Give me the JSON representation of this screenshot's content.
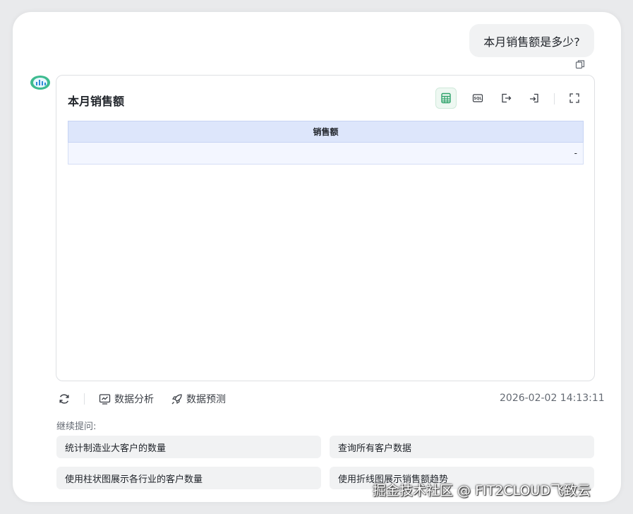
{
  "user_message": "本月销售额是多少?",
  "card": {
    "title": "本月销售额",
    "toolbar": [
      "table-icon",
      "sql-icon",
      "export-icon",
      "import-icon",
      "fullscreen-icon"
    ],
    "table": {
      "columns": [
        "销售额"
      ],
      "rows": [
        [
          "-"
        ]
      ]
    }
  },
  "actions": {
    "analyze_label": "数据分析",
    "predict_label": "数据预测"
  },
  "timestamp": "2026-02-02 14:13:11",
  "follow_up": {
    "label": "继续提问:",
    "suggestions": [
      "统计制造业大客户的数量",
      "查询所有客户数据",
      "使用柱状图展示各行业的客户数量",
      "使用折线图展示销售额趋势"
    ]
  },
  "watermark": "掘金技术社区 @ FIT2CLOUD飞致云",
  "colors": {
    "accent": "#2fa36b",
    "table_header": "#dde6fb"
  }
}
